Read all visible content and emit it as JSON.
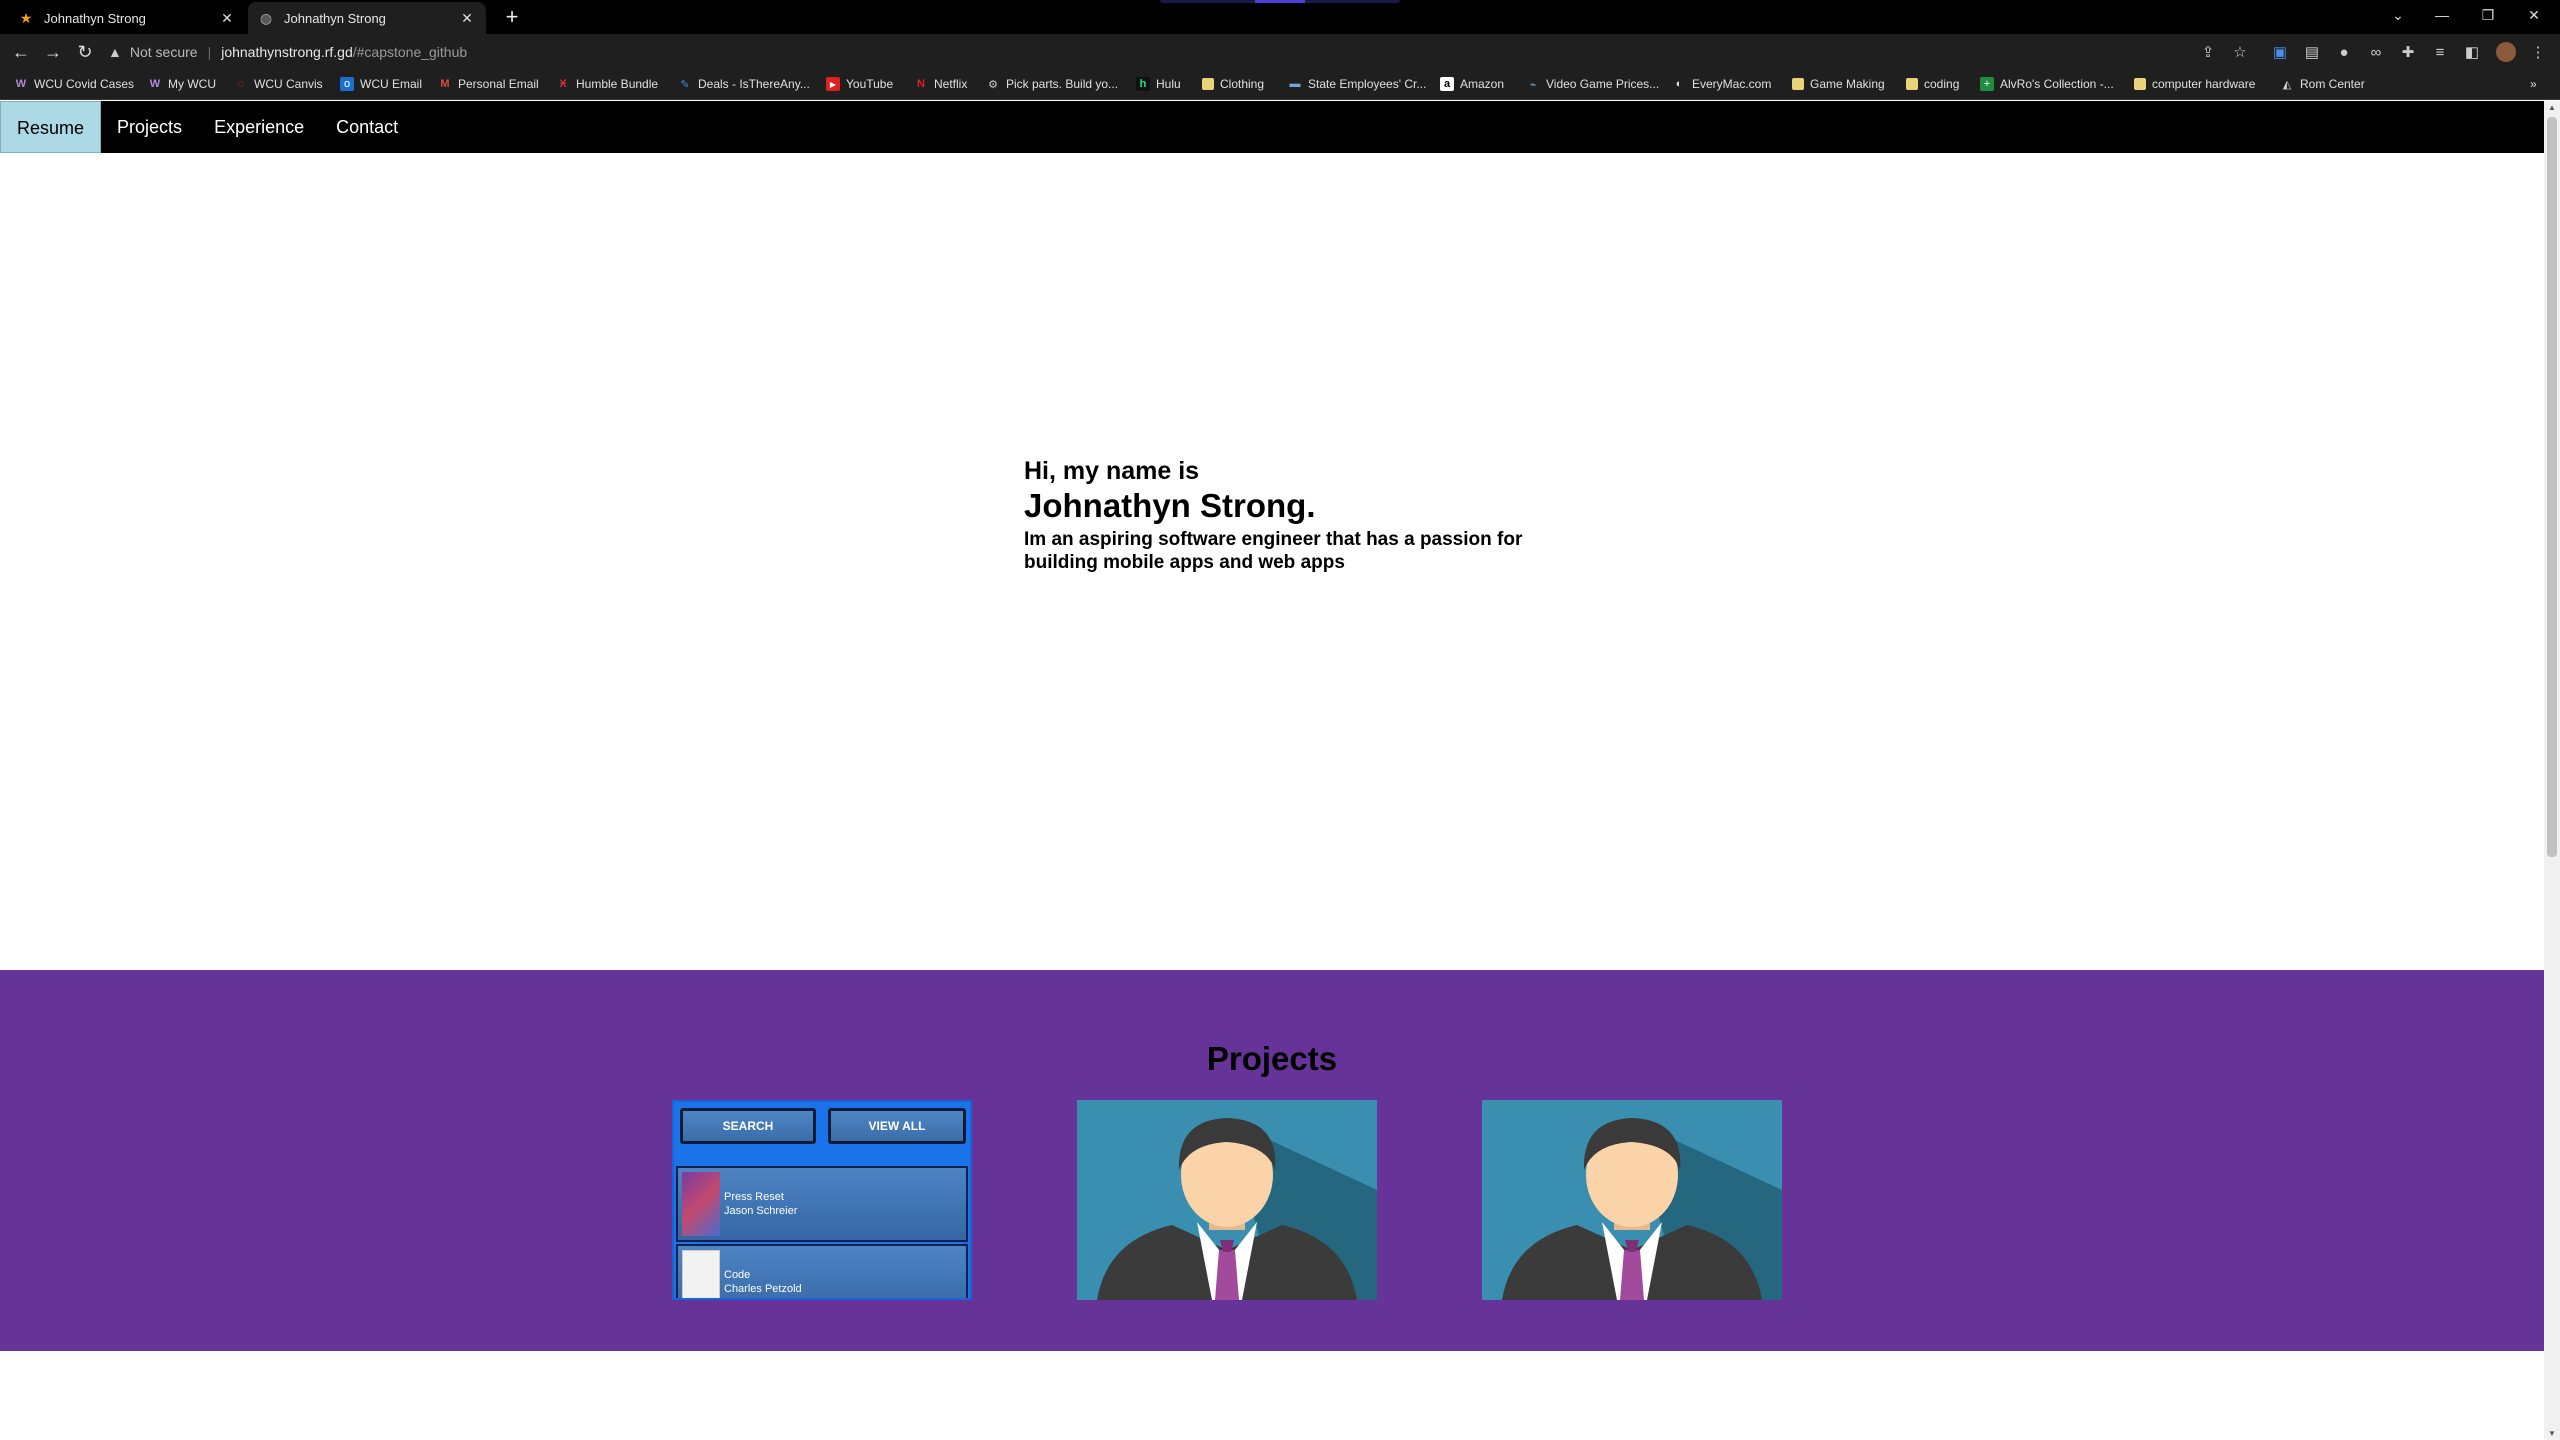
{
  "browser": {
    "tabs": [
      {
        "title": "Johnathyn Strong",
        "favicon": "star-favicon-icon",
        "active": false
      },
      {
        "title": "Johnathyn Strong",
        "favicon": "globe-favicon-icon",
        "active": true
      }
    ],
    "address": {
      "security_label": "Not secure",
      "host": "johnathynstrong.rf.gd",
      "path": "/#capstone_github"
    },
    "bookmarks": [
      {
        "label": "WCU Covid Cases",
        "icon": "wcu-icon"
      },
      {
        "label": "My WCU",
        "icon": "wcu-icon"
      },
      {
        "label": "WCU Canvis",
        "icon": "canvas-icon"
      },
      {
        "label": "WCU Email",
        "icon": "outlook-icon"
      },
      {
        "label": "Personal Email",
        "icon": "gmail-icon"
      },
      {
        "label": "Humble Bundle",
        "icon": "humble-icon"
      },
      {
        "label": "Deals - IsThereAny...",
        "icon": "deals-icon"
      },
      {
        "label": "YouTube",
        "icon": "youtube-icon"
      },
      {
        "label": "Netflix",
        "icon": "netflix-icon"
      },
      {
        "label": "Pick parts. Build yo...",
        "icon": "pcpartpicker-icon"
      },
      {
        "label": "Hulu",
        "icon": "hulu-icon"
      },
      {
        "label": "Clothing",
        "icon": "folder-icon"
      },
      {
        "label": "State Employees' Cr...",
        "icon": "bank-icon"
      },
      {
        "label": "Amazon",
        "icon": "amazon-icon"
      },
      {
        "label": "Video Game Prices...",
        "icon": "game-icon"
      },
      {
        "label": "EveryMac.com",
        "icon": "everymac-icon"
      },
      {
        "label": "Game Making",
        "icon": "folder-icon"
      },
      {
        "label": "coding",
        "icon": "folder-icon"
      },
      {
        "label": "AlvRo's Collection -...",
        "icon": "sheets-icon"
      },
      {
        "label": "computer hardware",
        "icon": "folder-icon"
      },
      {
        "label": "Rom Center",
        "icon": "romcenter-icon"
      }
    ]
  },
  "site": {
    "nav": [
      {
        "label": "Resume",
        "active": true
      },
      {
        "label": "Projects",
        "active": false
      },
      {
        "label": "Experience",
        "active": false
      },
      {
        "label": "Contact",
        "active": false
      }
    ],
    "hero": {
      "greeting": "Hi, my name is",
      "name": "Johnathyn Strong.",
      "tagline": "Im an aspiring software engineer that has a passion for building mobile apps and web apps"
    },
    "projects": {
      "heading": "Projects",
      "app_preview": {
        "search_label": "SEARCH",
        "view_all_label": "VIEW ALL",
        "books": [
          {
            "title": "Press Reset",
            "author": "Jason Schreier"
          },
          {
            "title": "Code",
            "author": "Charles Petzold"
          }
        ]
      }
    }
  },
  "colors": {
    "nav_bg": "#000000",
    "nav_active_bg": "#add8e6",
    "projects_bg": "#663399",
    "app_bg": "#1a73e8"
  }
}
